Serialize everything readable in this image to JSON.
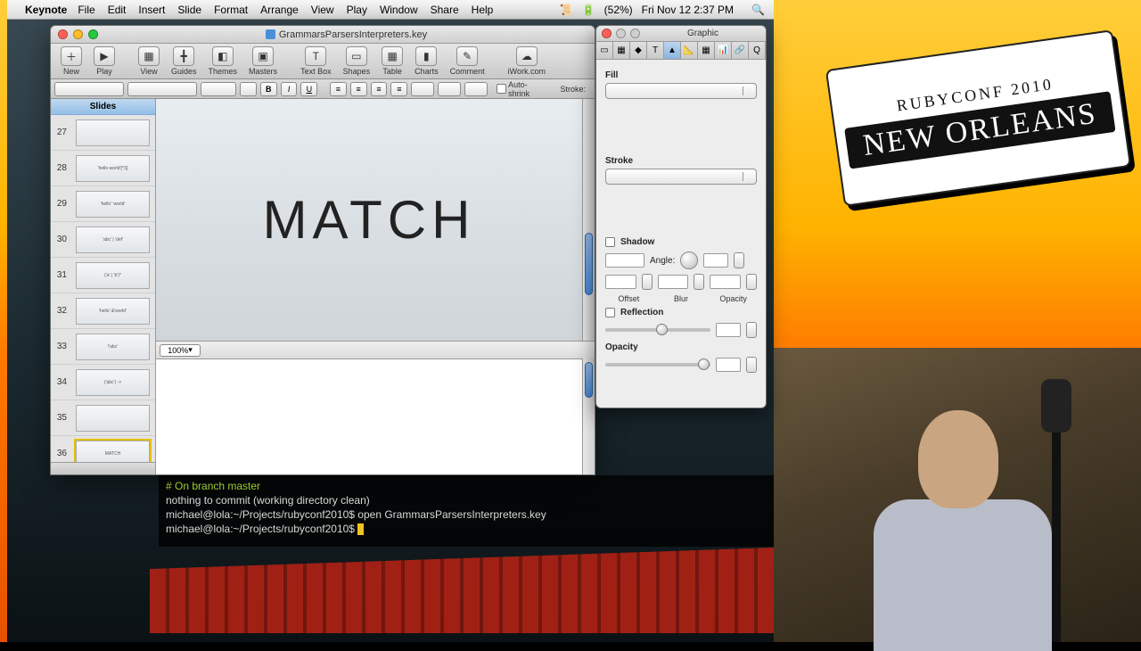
{
  "menubar": {
    "app": "Keynote",
    "items": [
      "File",
      "Edit",
      "Insert",
      "Slide",
      "Format",
      "Arrange",
      "View",
      "Play",
      "Window",
      "Share",
      "Help"
    ],
    "battery": "(52%)",
    "clock": "Fri Nov 12  2:37 PM"
  },
  "keynote": {
    "filename": "GrammarsParsersInterpreters.key",
    "toolbar": [
      {
        "id": "new",
        "label": "New",
        "glyph": "＋"
      },
      {
        "id": "play",
        "label": "Play",
        "glyph": "▶"
      },
      {
        "id": "view",
        "label": "View",
        "glyph": "▦"
      },
      {
        "id": "guides",
        "label": "Guides",
        "glyph": "╋"
      },
      {
        "id": "themes",
        "label": "Themes",
        "glyph": "◧"
      },
      {
        "id": "masters",
        "label": "Masters",
        "glyph": "▣"
      },
      {
        "id": "textbox",
        "label": "Text Box",
        "glyph": "T"
      },
      {
        "id": "shapes",
        "label": "Shapes",
        "glyph": "▭"
      },
      {
        "id": "table",
        "label": "Table",
        "glyph": "▦"
      },
      {
        "id": "charts",
        "label": "Charts",
        "glyph": "▮"
      },
      {
        "id": "comment",
        "label": "Comment",
        "glyph": "✎"
      },
      {
        "id": "iwork",
        "label": "iWork.com",
        "glyph": "☁"
      }
    ],
    "formatbar": {
      "autoshrink": "Auto-shrink",
      "stroke": "Stroke:"
    },
    "slides_header": "Slides",
    "slides": [
      {
        "n": 27,
        "txt": ""
      },
      {
        "n": 28,
        "txt": "'hello world'[^3]"
      },
      {
        "n": 29,
        "txt": "'hello' 'world'"
      },
      {
        "n": 30,
        "txt": "'abc' | 'def'"
      },
      {
        "n": 31,
        "txt": "('a' | 'b')*"
      },
      {
        "n": 32,
        "txt": "'hello' &'world'"
      },
      {
        "n": 33,
        "txt": "!'abc'"
      },
      {
        "n": 34,
        "txt": "('abc') ->"
      },
      {
        "n": 35,
        "txt": ""
      },
      {
        "n": 36,
        "txt": "MATCH",
        "sel": true
      }
    ],
    "zoom": "100%",
    "canvas_text": "MATCH"
  },
  "inspector": {
    "title": "Graphic",
    "fill": "Fill",
    "stroke": "Stroke",
    "shadow": "Shadow",
    "angle": "Angle:",
    "offset": "Offset",
    "blur": "Blur",
    "opacityS": "Opacity",
    "reflection": "Reflection",
    "opacity": "Opacity"
  },
  "terminal": {
    "l1": "# On branch master",
    "l2": "nothing to commit (working directory clean)",
    "l3p": "michael@lola:~/Projects/rubyconf2010$ ",
    "l3c": "open GrammarsParsersInterpreters.key",
    "l4": "michael@lola:~/Projects/rubyconf2010$ "
  },
  "badge": {
    "small": "RUBYCONF 2010",
    "big": "NEW ORLEANS"
  }
}
